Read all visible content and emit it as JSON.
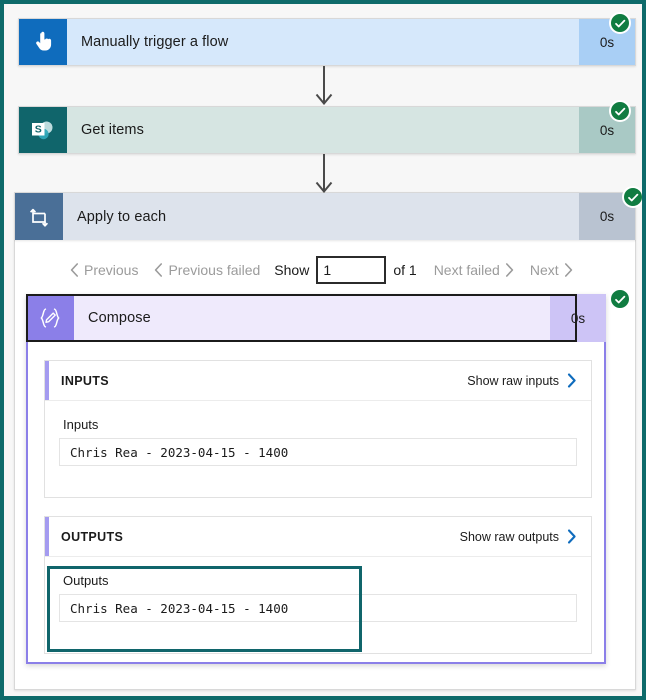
{
  "flow": {
    "steps": [
      {
        "name": "Manually trigger a flow",
        "duration": "0s",
        "icon": "hand-pointer-icon",
        "status": "succeeded"
      },
      {
        "name": "Get items",
        "duration": "0s",
        "icon": "sharepoint-icon",
        "status": "succeeded"
      },
      {
        "name": "Apply to each",
        "duration": "0s",
        "icon": "loop-repeat-icon",
        "status": "succeeded"
      },
      {
        "name": "Compose",
        "duration": "0s",
        "icon": "compose-braces-pencil-icon",
        "status": "succeeded"
      }
    ]
  },
  "pager": {
    "previous_label": "Previous",
    "previous_failed_label": "Previous failed",
    "show_label": "Show",
    "page_value": "1",
    "of_label": "of 1",
    "next_failed_label": "Next failed",
    "next_label": "Next"
  },
  "inputs_panel": {
    "header": "INPUTS",
    "raw_link": "Show raw inputs",
    "field_label": "Inputs",
    "field_value": "Chris Rea - 2023-04-15 - 1400"
  },
  "outputs_panel": {
    "header": "OUTPUTS",
    "raw_link": "Show raw outputs",
    "field_label": "Outputs",
    "field_value": "Chris Rea - 2023-04-15 - 1400"
  },
  "colors": {
    "outer_border": "#0e6b6b",
    "trigger_blue": "#d6e8fb",
    "sharepoint_teal": "#d6e5e2",
    "loop_slate": "#dde3ec",
    "compose_purple": "#8b7fe8",
    "success_green": "#107c41",
    "highlight_teal": "#10656b"
  }
}
